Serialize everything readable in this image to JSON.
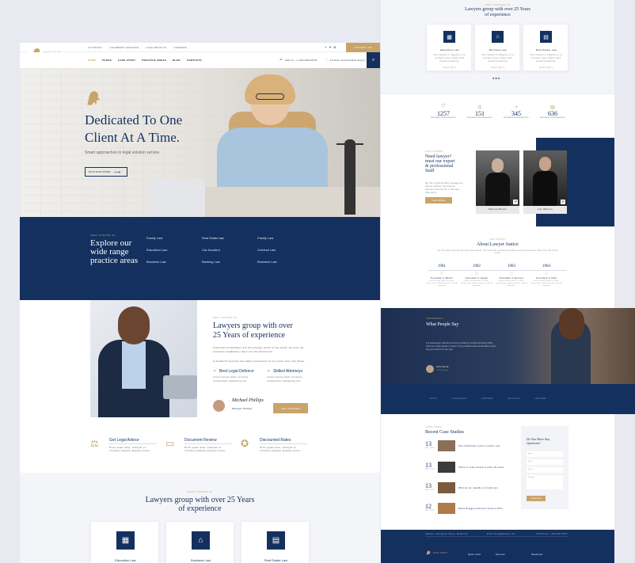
{
  "left": {
    "brand": "NOVA RIGHT",
    "topbar": {
      "links": [
        "ATTORNEY",
        "CHAMBERS SPEAKER",
        "CASE RESULTS",
        "CAREERS"
      ],
      "cta": "CONTACT US"
    },
    "nav": {
      "items": [
        "HOME",
        "PAGES",
        "CASE STUDY",
        "PRACTICE AREAS",
        "BLOG",
        "CONTACTS"
      ],
      "phone": "Call us : 1-234-000-5678",
      "hours": "24 Hour Accountable Everywhere"
    },
    "hero": {
      "title_line1": "Dedicated To One",
      "title_line2": "Client At A Time.",
      "subtitle": "Smart approaches to legal solution service.",
      "button": "EXPLORE MORE"
    },
    "practice": {
      "eyebrow": "WHAT CHOOSE US",
      "title_line1": "Explore our",
      "title_line2": "wide range",
      "title_line3": "practice areas",
      "areas": [
        [
          "Family Law",
          "Real Estate law",
          "Family Law"
        ],
        [
          "Education Law",
          "Car Accident",
          "Criminal Law"
        ],
        [
          "Business Law",
          "Banking Law",
          "Business Law"
        ]
      ]
    },
    "about": {
      "eyebrow": "WHO CHOOSE US",
      "title_line1": "Lawyers group with over",
      "title_line2": "25 Years of experience",
      "para1": "Industrial Consultation For the wrongs, forms of the world, far from the countries vocabulary, there live the blind texts.",
      "para2": "A wonderful serenity has taken possession of my entire soul, like these.",
      "feat1": "Best Legal Defence",
      "feat2": "Skilled Attorneys",
      "feat_text": "Lorem ipsum dolor sit amet, consectetur adipiscing elit.",
      "signature": "Michael Phillips",
      "signer": "Michael Phillips",
      "button": "GET STARTED"
    },
    "features": [
      {
        "title": "Get Legal Advice",
        "text": "Proin quam ante, volutpat et tincidunt adipisci aliquam lorem."
      },
      {
        "title": "Document Review",
        "text": "Proin quam ante, volutpat et tincidunt adipisci aliquam lorem."
      },
      {
        "title": "Discounted Rates",
        "text": "Proin quam ante, volutpat et tincidunt adipisci aliquam lorem."
      }
    ],
    "services": {
      "eyebrow": "WHAT CHOOSE US",
      "title_line1": "Lawyers group with over 25 Years",
      "title_line2": "of experience",
      "cards": [
        "Education Law",
        "Business Law",
        "Real Estate Law"
      ]
    }
  },
  "right": {
    "services": {
      "eyebrow": "WHAT CHOOSE US",
      "title_line1": "Lawyers group with over 25 Years",
      "title_line2": "of experience",
      "cards": [
        "Education Law",
        "Business Law",
        "Real Estate Law"
      ],
      "card_text": "Our lawyer's objects is to protect your rights and avoid problems.",
      "read_more": "Read More"
    },
    "stats": [
      {
        "value": "1257",
        "label": "BUSINESS REPRESENTED"
      },
      {
        "value": "151",
        "label": "BUSINESS REPRESENTED"
      },
      {
        "value": "345",
        "label": "BUSINESS REPRESENTED"
      },
      {
        "value": "636",
        "label": "BUSINESS REPRESENTED"
      }
    ],
    "team": {
      "eyebrow": "OUR ATTORNEY",
      "title_line1": "Need lawyer?",
      "title_line2": "meet our expert",
      "title_line3": "& professional",
      "title_line4": "Staff",
      "text": "We can professionally manage the task to achieve the desired outcome and can do it fast and effectively.",
      "button": "VIEW MORE",
      "members": [
        "Marcus Brown",
        "Lily Watson"
      ]
    },
    "history": {
      "eyebrow": "OUR HISTORY",
      "title": "About Lawyer Justice",
      "intro": "Far far away behind the word mountains, far from the countries Vokalia and Consonantia, there live the blind texts.",
      "items": [
        {
          "year": "1981",
          "title": "Founded in Berlin"
        },
        {
          "year": "1982",
          "title": "Founded in Japan"
        },
        {
          "year": "1983",
          "title": "Founded in Europe"
        },
        {
          "year": "1984",
          "title": "Founded in USA"
        }
      ],
      "item_text": "Lorem ipsum dolor sit amet, consectetur adipiscing elit, sed do eiusmod."
    },
    "testimonial": {
      "eyebrow": "TESTIMONIALS",
      "title": "What People Say",
      "quote": "I've been happy with the services provided by Lawyer Attorneys Firm. John was really patient to listen to my problems and took the time to give me good advice for the case.",
      "author": "John Smith",
      "role": "CEO Founder"
    },
    "logos": [
      "RIVEN",
      "CONSULTANT",
      "LAWYERS",
      "ADVOCATE",
      "LAW FIRM"
    ],
    "cases": {
      "eyebrow": "LATEST NEWS",
      "title": "Recent Case Studies",
      "posts": [
        {
          "day": "13",
          "month": "DEC 2023",
          "title": "How A Mediation Could in Family Law"
        },
        {
          "day": "13",
          "month": "DEC 2023",
          "title": "Offers to strike missed to plans the basis."
        },
        {
          "day": "13",
          "month": "DEC 2023",
          "title": "What we are capable of visually get."
        },
        {
          "day": "12",
          "month": "DEC 2023",
          "title": "Books Bragging Domestic Violence Bills..."
        }
      ],
      "form_title_line1": "Do You Have Any",
      "form_title_line2": "Questions?",
      "form_fields": [
        "Name",
        "Email",
        "Phone",
        "Message"
      ],
      "form_button": "SUBMIT NOW"
    },
    "footer": {
      "address": "Address: 123 Queen Street, Melbourne",
      "email": "Email: hello@domain.com",
      "phone": "Call Phone: 1-234-000-5678",
      "brand": "NOVA RIGHT",
      "col1": "Quick Links",
      "col2": "Services",
      "col3": "Newsletter"
    }
  }
}
